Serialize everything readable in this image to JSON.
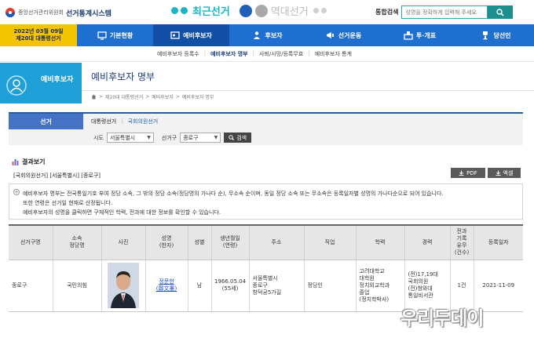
{
  "header": {
    "org": "중앙선거관리위원회",
    "system": "선거통계시스템",
    "tab_recent": "최근선거",
    "tab_past": "역대선거",
    "search_label": "통합검색",
    "search_placeholder": "성명을 정확하게 입력해 주세요"
  },
  "nav": {
    "date_line1": "2022년 03월 09일",
    "date_line2": "제20대 대통령선거",
    "items": [
      {
        "label": "기본현황",
        "icon": "monitor-icon"
      },
      {
        "label": "예비후보자",
        "icon": "id-card-icon"
      },
      {
        "label": "후보자",
        "icon": "person-icon"
      },
      {
        "label": "선거운동",
        "icon": "megaphone-icon"
      },
      {
        "label": "투·개표",
        "icon": "ballot-box-icon"
      },
      {
        "label": "당선인",
        "icon": "trophy-icon"
      }
    ]
  },
  "subnav": {
    "items": [
      "예비후보자 등록수",
      "예비후보자 명부",
      "사퇴/사망/등록무효",
      "예비후보자 통계"
    ],
    "active_index": 1
  },
  "section": {
    "side_label": "예비후보자",
    "page_title": "예비후보자 명부",
    "breadcrumb": [
      "제20대 대통령선거",
      "예비후보자",
      "예비후보자 명부"
    ]
  },
  "filter": {
    "election_label": "선거",
    "types": [
      "대통령선거",
      "국회의원선거"
    ],
    "city_label": "시도",
    "city_value": "서울특별시",
    "district_label": "선거구",
    "district_value": "종로구",
    "search_button": "검색"
  },
  "results": {
    "title": "결과보기",
    "conditions": "[국회의원선거] [서울특별시] [종로구]",
    "pdf_button": "PDF",
    "excel_button": "엑셀",
    "notes": [
      "예비후보자 명부는 전국통일기호 부여 정당 소속, 그 밖의 정당 소속(정당명의 가나다 순), 무소속 순이며, 동일 정당 소속 또는 무소속은 등록일자별 성명의 가나다순으로 되어 있습니다.",
      "또한 연령은 선거일 현재로 산정됩니다.",
      "예비후보자의 성명을 클릭하면 구체적인 학력, 전과에 대한 정보를 확인할 수 있습니다."
    ]
  },
  "table": {
    "headers": [
      [
        "선거구명"
      ],
      [
        "소속",
        "정당명"
      ],
      [
        "사진"
      ],
      [
        "성명",
        "(한자)"
      ],
      [
        "성별"
      ],
      [
        "생년월일",
        "(연령)"
      ],
      [
        "주소"
      ],
      [
        "직업"
      ],
      [
        "학력"
      ],
      [
        "경력"
      ],
      [
        "전과",
        "기록",
        "유무",
        "(건수)"
      ],
      [
        "등록일자"
      ]
    ],
    "row": {
      "district": "종로구",
      "party": "국민의힘",
      "name": "정문헌",
      "name_hanja": "(鄭文憲)",
      "gender": "남",
      "birth": "1966.05.04",
      "age": "(55세)",
      "address": [
        "서울특별시",
        "종로구",
        "창덕궁5가길"
      ],
      "job": "정당인",
      "education": [
        "고려대학교",
        "대학원",
        "정치외교학과",
        "졸업",
        "(정치학박사)"
      ],
      "career": [
        "(전)17,19대",
        "국회의원",
        "(전)청와대",
        "통일비서관"
      ],
      "criminal": "1건",
      "registered": "2021-11-09"
    }
  },
  "watermark": "우리두데이",
  "colors": {
    "nav_blue": "#1f6fd1",
    "nav_date_yellow": "#f4c400",
    "teal": "#19b4c5",
    "side_blue": "#20a0d8",
    "link_blue": "#1c4fb8"
  }
}
